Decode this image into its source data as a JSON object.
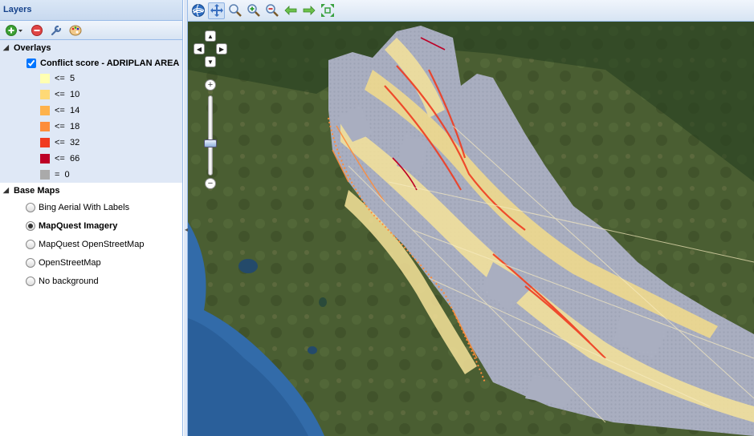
{
  "panel": {
    "title": "Layers",
    "toolbar": {
      "add_icon": "add-layer-icon",
      "remove_icon": "remove-layer-icon",
      "properties_icon": "wrench-icon",
      "style_icon": "palette-icon"
    },
    "overlays": {
      "title": "Overlays",
      "layer": {
        "label": "Conflict score - ADRIPLAN AREA",
        "checked": true
      },
      "legend": [
        {
          "label": "<=  5",
          "color": "#ffffb2"
        },
        {
          "label": "<=  10",
          "color": "#fed976"
        },
        {
          "label": "<=  14",
          "color": "#feb24c"
        },
        {
          "label": "<=  18",
          "color": "#fd8d3c"
        },
        {
          "label": "<=  32",
          "color": "#f03b20"
        },
        {
          "label": "<=  66",
          "color": "#bd0026"
        },
        {
          "label": "=  0",
          "color": "#aaaaaa"
        }
      ]
    },
    "base_maps": {
      "title": "Base Maps",
      "items": [
        {
          "label": "Bing Aerial With Labels",
          "selected": false
        },
        {
          "label": "MapQuest Imagery",
          "selected": true
        },
        {
          "label": "MapQuest OpenStreetMap",
          "selected": false
        },
        {
          "label": "OpenStreetMap",
          "selected": false
        },
        {
          "label": "No background",
          "selected": false
        }
      ]
    }
  },
  "map_toolbar": {
    "tools": [
      {
        "icon": "globe-icon",
        "pressed": false
      },
      {
        "icon": "pan-icon",
        "pressed": true
      },
      {
        "icon": "zoom-box-icon",
        "pressed": false
      },
      {
        "icon": "zoom-in-icon",
        "pressed": false
      },
      {
        "icon": "zoom-out-icon",
        "pressed": false
      },
      {
        "icon": "back-arrow-icon",
        "pressed": false
      },
      {
        "icon": "forward-arrow-icon",
        "pressed": false
      },
      {
        "icon": "zoom-extent-icon",
        "pressed": false
      }
    ]
  },
  "map": {
    "zoom_level_fraction": 0.6,
    "colors": {
      "land": "#4a5e32",
      "sea": "#2a5f9a",
      "grid": "#a9aec0"
    }
  }
}
